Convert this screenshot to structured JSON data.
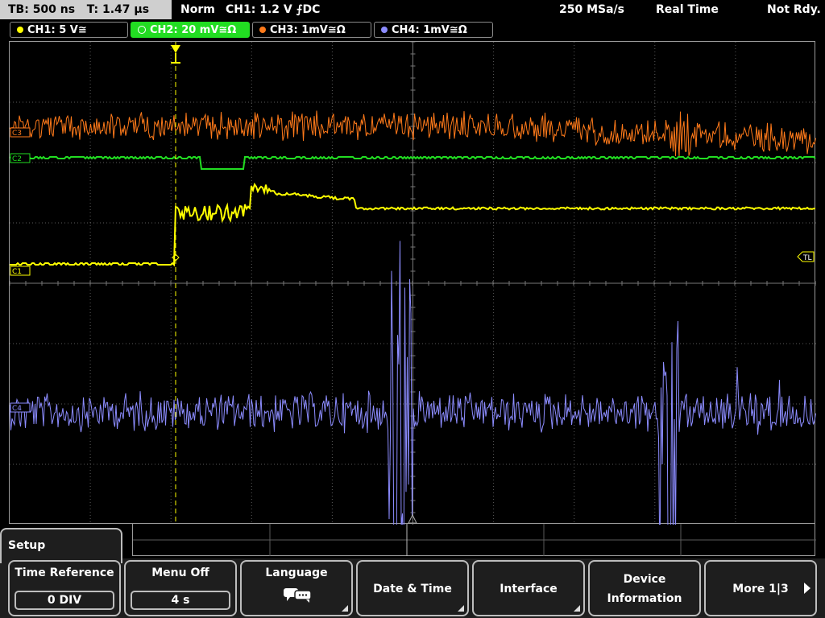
{
  "topbar": {
    "timebase": "TB: 500 ns",
    "trigger_time": "T: 1.47 µs",
    "mode": "Norm",
    "trigger_info": "CH1: 1.2 V ⨍DC",
    "sample_rate": "250 MSa/s",
    "acq_mode": "Real Time",
    "status": "Not Rdy."
  },
  "channels": [
    {
      "label": "CH1: 5 V≅",
      "color": "#ffff00",
      "active": false
    },
    {
      "label": "CH2: 20 mV≅Ω",
      "color": "#22dd22",
      "active": true
    },
    {
      "label": "CH3: 1mV≅Ω",
      "color": "#ff7a1a",
      "active": false
    },
    {
      "label": "CH4: 1mV≅Ω",
      "color": "#8c8cff",
      "active": false
    }
  ],
  "scope": {
    "markers": {
      "c1": "C1",
      "c2": "C2",
      "c3": "C3",
      "c4": "C4",
      "trigger_level": "TL"
    },
    "colors": {
      "ch1": "#ffff00",
      "ch2": "#22dd22",
      "ch3": "#ff7a1a",
      "ch4": "#8c8cff",
      "grid": "#5a5a5a"
    }
  },
  "menu": {
    "title": "Setup",
    "keys": {
      "time_reference": {
        "label": "Time Reference",
        "value": "0 DIV"
      },
      "menu_off": {
        "label": "Menu Off",
        "value": "4 s"
      },
      "language": {
        "label": "Language",
        "icon": "speech-bubbles-icon"
      },
      "date_time": {
        "label": "Date & Time"
      },
      "interface": {
        "label": "Interface"
      },
      "device_information": {
        "line1": "Device",
        "line2": "Information"
      },
      "more": {
        "label": "More 1|3"
      }
    }
  }
}
